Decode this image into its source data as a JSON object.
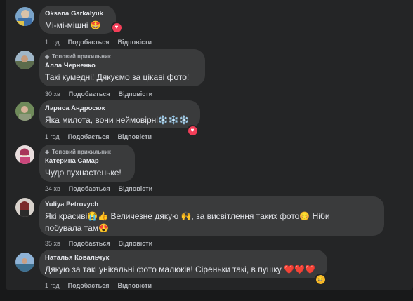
{
  "comments": [
    {
      "author": "Oksana Garkalyuk",
      "text": "Мі-мі-мішні 🤩",
      "time": "1 год",
      "like": "Подобається",
      "reply": "Відповісти",
      "reaction": "love"
    },
    {
      "badge": "Топовий прихильник",
      "author": "Алла Черненко",
      "text": "Такі кумедні! Дякуємо за цікаві фото!",
      "time": "30 хв",
      "like": "Подобається",
      "reply": "Відповісти"
    },
    {
      "author": "Лариса Андросюк",
      "text": "Яка милота, вони неймовірні❄️❄️❄️",
      "time": "1 год",
      "like": "Подобається",
      "reply": "Відповісти",
      "reaction": "love"
    },
    {
      "badge": "Топовий прихильник",
      "author": "Катерина Самар",
      "text": "Чудо пухнастеньке!",
      "time": "24 хв",
      "like": "Подобається",
      "reply": "Відповісти"
    },
    {
      "author": "Yuliya Petrovych",
      "text_line1": "Які красиві😭👍 Величезне дякую 🙌, за висвітлення таких фото😊 Ніби",
      "text_line2": "побувала там😍",
      "time": "35 хв",
      "like": "Подобається",
      "reply": "Відповісти"
    },
    {
      "author": "Наталья Ковальчук",
      "text": "Дякую за такі унікальні фото малюків! Сіреньки такі, в пушку ❤️❤️❤️",
      "time": "1 год",
      "like": "Подобається",
      "reply": "Відповісти",
      "reaction": "haha"
    }
  ],
  "colors": {
    "background": "#18191a",
    "panel": "#242526",
    "bubble": "#3a3b3c",
    "text": "#e4e6eb",
    "secondary": "#b0b3b8",
    "love": "#f33e58",
    "haha": "#f7b928"
  }
}
